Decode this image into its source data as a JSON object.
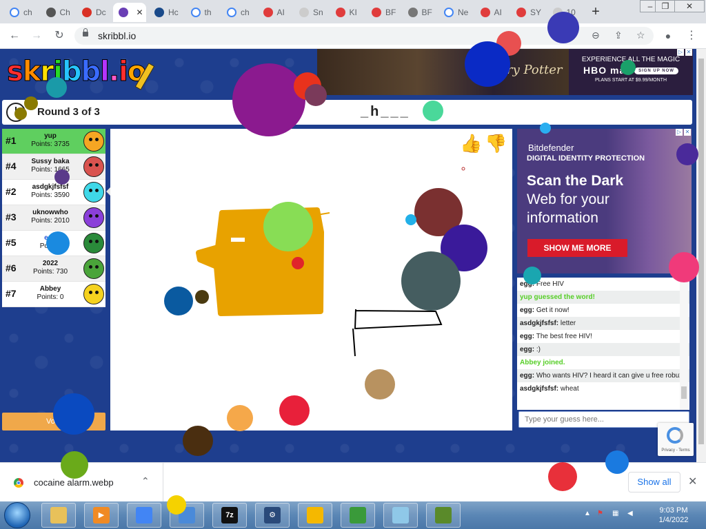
{
  "browser": {
    "tabs": [
      {
        "label": "ch",
        "icon": "google-icon",
        "color": "#ffffff"
      },
      {
        "label": "Ch",
        "icon": "gear-icon",
        "color": "#555555"
      },
      {
        "label": "Dc",
        "icon": "gmail-icon",
        "color": "#d93025"
      },
      {
        "label": "",
        "icon": "skribbl-icon",
        "color": "#6a3fb5"
      },
      {
        "label": "Hc",
        "icon": "circle-logo-icon",
        "color": "#1a4a8a"
      },
      {
        "label": "th",
        "icon": "google-icon",
        "color": "#ffffff"
      },
      {
        "label": "ch",
        "icon": "google-icon",
        "color": "#ffffff"
      },
      {
        "label": "AI",
        "icon": "g-red-icon",
        "color": "#e03c3c"
      },
      {
        "label": "Sn",
        "icon": "blank-icon",
        "color": "#cccccc"
      },
      {
        "label": "KI",
        "icon": "g-red-icon",
        "color": "#e03c3c"
      },
      {
        "label": "BF",
        "icon": "g-red-icon",
        "color": "#e03c3c"
      },
      {
        "label": "BF",
        "icon": "globe-icon",
        "color": "#777777"
      },
      {
        "label": "Ne",
        "icon": "google-icon",
        "color": "#ffffff"
      },
      {
        "label": "AI",
        "icon": "g-red-icon",
        "color": "#e03c3c"
      },
      {
        "label": "SY",
        "icon": "g-red-icon",
        "color": "#e03c3c"
      },
      {
        "label": "10",
        "icon": "blank-icon",
        "color": "#cccccc"
      }
    ],
    "new_tab": "+",
    "minimize": "–",
    "restore": "❐",
    "close": "✕",
    "back": "←",
    "forward": "→",
    "reload": "↻",
    "url": "skribbl.io",
    "zoom_icon": "⊖",
    "share_icon": "⇪",
    "star_icon": "☆",
    "profile_icon": "●",
    "menu_icon": "⋮"
  },
  "game": {
    "logo_letters": [
      {
        "ch": "s",
        "color": "#ff2e2e"
      },
      {
        "ch": "k",
        "color": "#ff8c00"
      },
      {
        "ch": "r",
        "color": "#ffe000"
      },
      {
        "ch": "i",
        "color": "#28d928"
      },
      {
        "ch": "b",
        "color": "#27c4ff"
      },
      {
        "ch": "b",
        "color": "#3a6bff"
      },
      {
        "ch": "l",
        "color": "#b534ff"
      },
      {
        "ch": ".",
        "color": "#ff5ac8"
      },
      {
        "ch": "i",
        "color": "#ff2e2e"
      },
      {
        "ch": "o",
        "color": "#ffa500"
      }
    ],
    "round_text": "Round 3 of 3",
    "word_hint": "_h___",
    "players": [
      {
        "rank": "#1",
        "name": "yup",
        "points": "Points: 3735",
        "avatar_color": "#f5a623",
        "highlight": true
      },
      {
        "rank": "#4",
        "name": "Sussy baka",
        "points": "Points: 1665",
        "avatar_color": "#d9534f",
        "highlight": false
      },
      {
        "rank": "#2",
        "name": "asdgkjfsfsf",
        "points": "Points: 3590",
        "avatar_color": "#3fd8e8",
        "highlight": false
      },
      {
        "rank": "#3",
        "name": "uknowwho",
        "points": "Points: 2010",
        "avatar_color": "#8a3fd9",
        "highlight": false
      },
      {
        "rank": "#5",
        "name": "egg",
        "points": "Points:",
        "avatar_color": "#2a8a3a",
        "highlight": false
      },
      {
        "rank": "#6",
        "name": "2022",
        "points": "Points: 730",
        "avatar_color": "#4aa43a",
        "highlight": false
      },
      {
        "rank": "#7",
        "name": "Abbey",
        "points": "Points: 0",
        "avatar_color": "#f5d21f",
        "highlight": false
      }
    ],
    "bubble_text": "wheat",
    "vote_label": "Vote",
    "like_icon": "👍",
    "dislike_icon": "👎",
    "chat": [
      {
        "user": "egg:",
        "text": "Free HIV",
        "system": false
      },
      {
        "user": "",
        "text": "yup guessed the word!",
        "system": true
      },
      {
        "user": "egg:",
        "text": "Get it now!",
        "system": false
      },
      {
        "user": "asdgkjfsfsf:",
        "text": "letter",
        "system": false
      },
      {
        "user": "egg:",
        "text": "The best free HIV!",
        "system": false
      },
      {
        "user": "egg:",
        "text": ":)",
        "system": false
      },
      {
        "user": "",
        "text": "Abbey joined.",
        "system": true
      },
      {
        "user": "egg:",
        "text": "Who wants HIV? I heard it can give u free robux",
        "system": false
      },
      {
        "user": "asdgkjfsfsf:",
        "text": "wheat",
        "system": false
      }
    ],
    "guess_placeholder": "Type your guess here...",
    "recaptcha_text": "Privacy - Terms"
  },
  "ads": {
    "top": {
      "movie_text": "Harry Potter",
      "line1": "EXPERIENCE ALL THE MAGIC",
      "brand": "HBO max",
      "button": "SIGN UP NOW",
      "small": "PLANS START AT $9.99/MONTH"
    },
    "right": {
      "brand": "Bitdefender",
      "tagline": "DIGITAL IDENTITY PROTECTION",
      "headline1": "Scan the Dark",
      "headline2": "Web for your",
      "headline3": "information",
      "button": "SHOW ME MORE"
    },
    "close_icon": "✕"
  },
  "download_bar": {
    "file_name": "cocaine alarm.webp",
    "chevron": "⌃",
    "show_all": "Show all",
    "close": "✕"
  },
  "taskbar": {
    "time": "9:03 PM",
    "date": "1/4/2022",
    "apps": [
      {
        "name": "explorer",
        "color": "#e8c15a",
        "label": ""
      },
      {
        "name": "media-player",
        "color": "#f08a24",
        "label": "▶"
      },
      {
        "name": "chrome",
        "color": "#4285f4",
        "label": ""
      },
      {
        "name": "control-panel",
        "color": "#4a8ad9",
        "label": ""
      },
      {
        "name": "7zip",
        "color": "#111111",
        "label": "7z"
      },
      {
        "name": "settings-gear",
        "color": "#2a4a7a",
        "label": "⚙"
      },
      {
        "name": "vpn-shield",
        "color": "#f5b800",
        "label": ""
      },
      {
        "name": "network",
        "color": "#3a9a3a",
        "label": ""
      },
      {
        "name": "notepad",
        "color": "#8fc8e8",
        "label": ""
      },
      {
        "name": "minecraft",
        "color": "#5a8a2a",
        "label": ""
      }
    ]
  },
  "colors": {
    "page_bg": "#1e3e8e",
    "first_place": "#5fcf5f",
    "drawing_orange": "#e8a200",
    "system_msg": "#56ce27",
    "ad_button_red": "#d91b2a"
  }
}
